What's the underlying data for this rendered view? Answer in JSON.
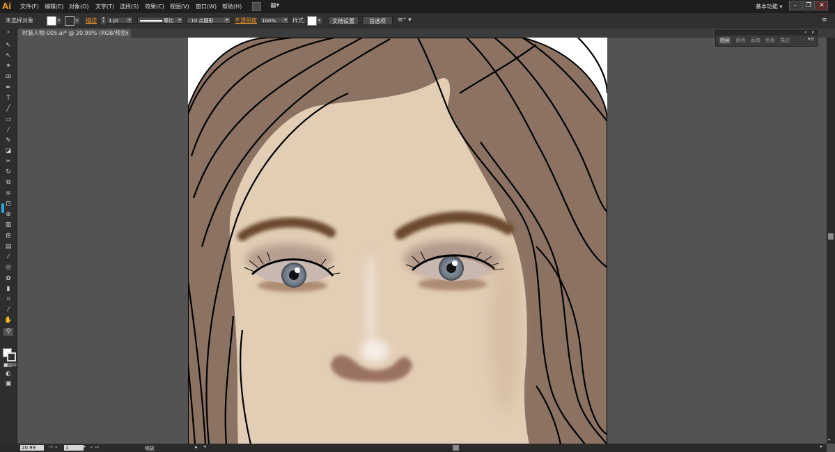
{
  "app": {
    "logo": "Ai"
  },
  "menu": [
    "文件(F)",
    "编辑(E)",
    "对象(O)",
    "文字(T)",
    "选择(S)",
    "效果(C)",
    "视图(V)",
    "窗口(W)",
    "帮助(H)"
  ],
  "workspace_label": "基本功能",
  "control_bar": {
    "selection_status": "未选择对象",
    "stroke_label": "描边",
    "stroke_weight": "1 pt",
    "stroke_profile": "等比",
    "brush": "10 点圆形",
    "opacity_label": "不透明度",
    "opacity_value": "100%",
    "style_label": "样式:",
    "doc_setup_button": "文档设置",
    "preferences_button": "首选项"
  },
  "document_tab": {
    "title": "时装人物-005.ai* @ 20.99% (RGB/预览)",
    "close": "×"
  },
  "panel": {
    "tabs": [
      "图层",
      "颜色",
      "画笔",
      "色板",
      "描边"
    ],
    "active_tab": "图层"
  },
  "status_bar": {
    "zoom": "20.99",
    "page": "1",
    "tool_name": "缩放"
  },
  "colors": {
    "accent": "#f79c2b",
    "skin": "#e2cdb5",
    "hair": "#8b7262",
    "brow": "#6b4a2e",
    "iris": "#7f8a96",
    "nose_shadow": "#9a7264"
  }
}
